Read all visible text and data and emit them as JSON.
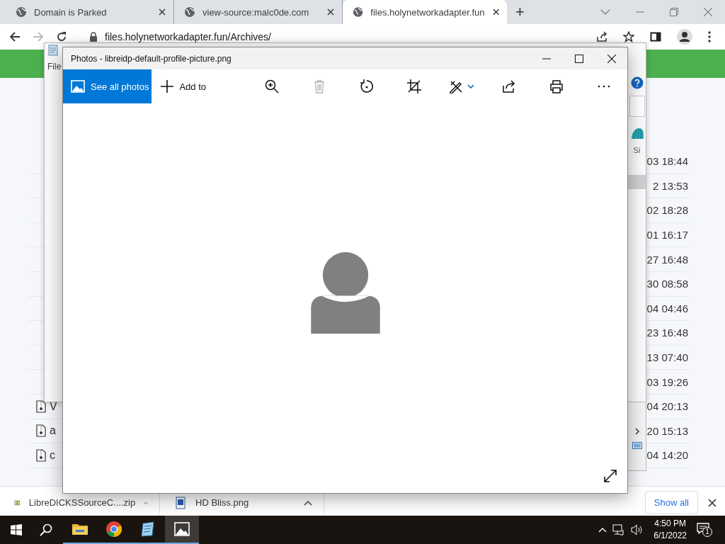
{
  "browser": {
    "tabs": [
      {
        "title": "Domain is Parked",
        "selected": false
      },
      {
        "title": "view-source:malc0de.com",
        "selected": false
      },
      {
        "title": "files.holynetworkadapter.fun",
        "selected": true
      }
    ],
    "new_tab": "+",
    "address": "files.holynetworkadapter.fun/Archives/",
    "rows": [
      {
        "date_time": "03 18:44"
      },
      {
        "date_time": "2 13:53"
      },
      {
        "date_time": "02 18:28"
      },
      {
        "date_time": "01 16:17"
      },
      {
        "date_time": "27 16:48"
      },
      {
        "date_time": "30 08:58"
      },
      {
        "date_time": "04 04:46"
      },
      {
        "date_time": "23 16:48"
      },
      {
        "date_time": "13 07:40"
      },
      {
        "date_time": "03 19:26"
      },
      {
        "name": "V",
        "date_time": "04 20:13"
      },
      {
        "name": "a",
        "date_time": "20 15:13"
      },
      {
        "name": "c",
        "date_time": "04 14:20"
      }
    ]
  },
  "back_window": {
    "menu": "File",
    "column_header": "Si"
  },
  "photos": {
    "title": "Photos - libreidp-default-profile-picture.png",
    "buttons": [
      {
        "label": "See all photos",
        "kind": "primary"
      },
      {
        "label": "Add to",
        "kind": "plain"
      }
    ],
    "tools": [
      {
        "kind": "zoom",
        "disabled": false
      },
      {
        "kind": "delete",
        "disabled": true
      },
      {
        "kind": "rotate",
        "disabled": false
      },
      {
        "kind": "crop",
        "disabled": false
      },
      {
        "kind": "edit",
        "disabled": false
      },
      {
        "kind": "share",
        "disabled": false
      },
      {
        "kind": "print",
        "disabled": false
      },
      {
        "kind": "more",
        "disabled": false
      }
    ]
  },
  "downloads": {
    "items": [
      {
        "name": "LibreDICKSSourceC....zip",
        "kind": "zip"
      },
      {
        "name": "HD Bliss.png",
        "kind": "image"
      }
    ],
    "show_all": "Show all"
  },
  "taskbar": {
    "apps": [
      {
        "kind": "explorer",
        "selected": false
      },
      {
        "kind": "chrome",
        "selected": false
      },
      {
        "kind": "notepad",
        "selected": false
      },
      {
        "kind": "photos",
        "selected": true
      }
    ],
    "time": "4:50 PM",
    "date": "6/1/2022",
    "notifications": "1"
  }
}
